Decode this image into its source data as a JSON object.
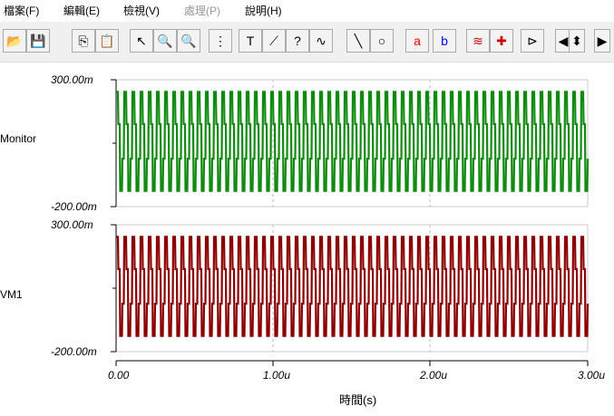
{
  "menu": [
    "檔案(F)",
    "編輯(E)",
    "檢視(V)",
    "處理(P)",
    "說明(H)"
  ],
  "toolbar": [
    "open-icon",
    "save-icon",
    "copy-icon",
    "paste-icon",
    "pointer-icon",
    "zoom-in-icon",
    "zoom-100-icon",
    "grid-icon",
    "text-icon",
    "annotate-icon",
    "annotate-question-icon",
    "annotate-formula-icon",
    "line-icon",
    "circle-icon",
    "cursor-a-icon",
    "cursor-b-icon",
    "add-curve-icon",
    "add-probe-icon",
    "flag-icon",
    "scroll-left-icon",
    "scroll-updown-icon",
    "scroll-right-icon"
  ],
  "colors": {
    "monitor": "#108a10",
    "vm1": "#8b0000"
  },
  "plots": [
    {
      "name": "Monitor",
      "ymax": "300.00m",
      "ymin": "-200.00m"
    },
    {
      "name": "VM1",
      "ymax": "300.00m",
      "ymin": "-200.00m"
    }
  ],
  "xaxis": {
    "ticks": [
      "0.00",
      "1.00u",
      "2.00u",
      "3.00u"
    ],
    "label": "時間(s)"
  }
}
